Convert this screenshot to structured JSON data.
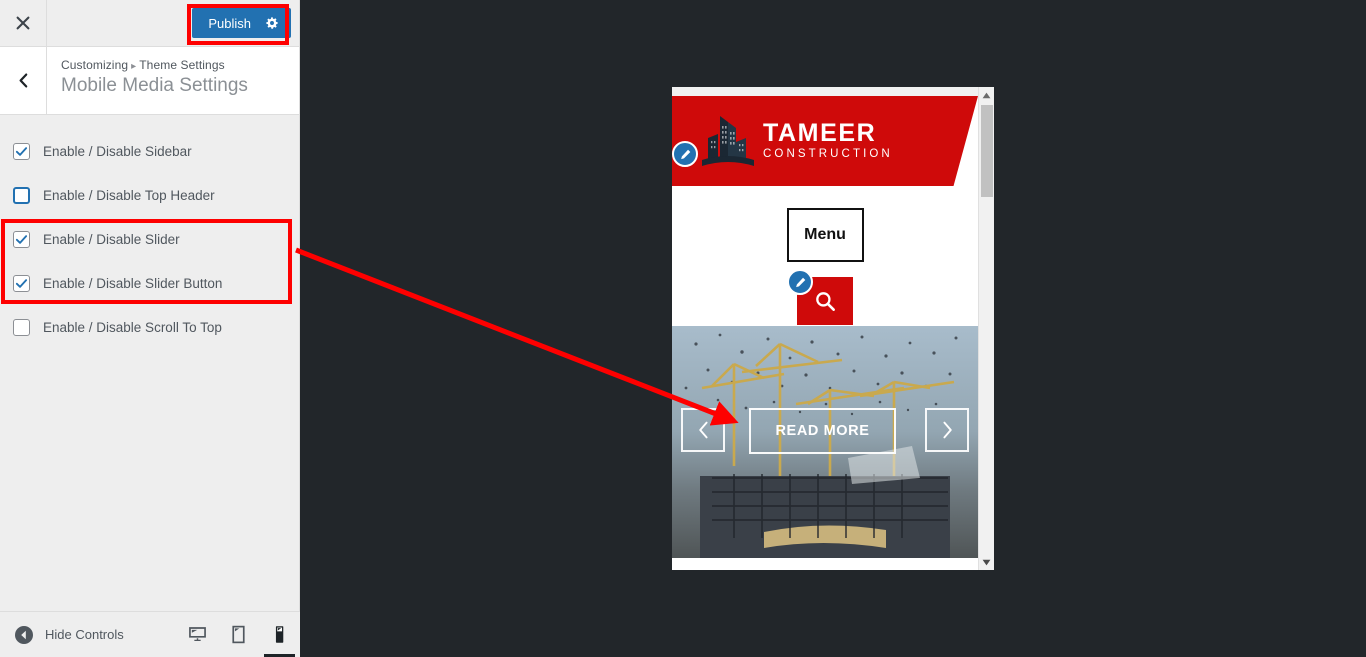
{
  "customizer": {
    "close_icon": "close-icon",
    "publish": {
      "label": "Publish",
      "icon": "gear-icon",
      "color": "#2271b1"
    },
    "back_icon": "chevron-left-icon",
    "breadcrumb": {
      "root": "Customizing",
      "separator": "▸",
      "section": "Theme Settings"
    },
    "panel_title": "Mobile Media Settings",
    "controls": [
      {
        "label": "Enable / Disable Sidebar",
        "checked": true,
        "focused": false
      },
      {
        "label": "Enable / Disable Top Header",
        "checked": false,
        "focused": true
      },
      {
        "label": "Enable / Disable Slider",
        "checked": true,
        "focused": false
      },
      {
        "label": "Enable / Disable Slider Button",
        "checked": true,
        "focused": false
      },
      {
        "label": "Enable / Disable Scroll To Top",
        "checked": false,
        "focused": false
      }
    ],
    "footer": {
      "hide_controls_label": "Hide Controls",
      "hide_controls_icon": "collapse-left-icon",
      "devices": [
        {
          "name": "desktop",
          "icon": "desktop-icon",
          "active": false
        },
        {
          "name": "tablet",
          "icon": "tablet-icon",
          "active": false
        },
        {
          "name": "mobile",
          "icon": "mobile-icon",
          "active": true
        }
      ]
    }
  },
  "preview": {
    "site": {
      "logo": {
        "title": "TAMEER",
        "subtitle": "CONSTRUCTION",
        "icon": "buildings-icon",
        "background": "#cf0a0a"
      },
      "menu_button": "Menu",
      "search_icon": "search-icon",
      "slider": {
        "prev_icon": "chevron-left-icon",
        "next_icon": "chevron-right-icon",
        "button_label": "READ MORE",
        "image_alt": "construction-cranes-photo"
      }
    },
    "edit_shortcuts": [
      {
        "name": "edit-shortcut-header",
        "icon": "pencil-icon"
      },
      {
        "name": "edit-shortcut-search",
        "icon": "pencil-icon"
      }
    ],
    "scrollbar": {
      "up_icon": "caret-up-icon",
      "down_icon": "caret-down-icon"
    }
  },
  "annotations": {
    "color": "#fe0000",
    "rect_publish": "publish-button-highlight",
    "rect_slider_group": "slider-controls-highlight",
    "arrow": "points-to-slider-read-more-button"
  }
}
